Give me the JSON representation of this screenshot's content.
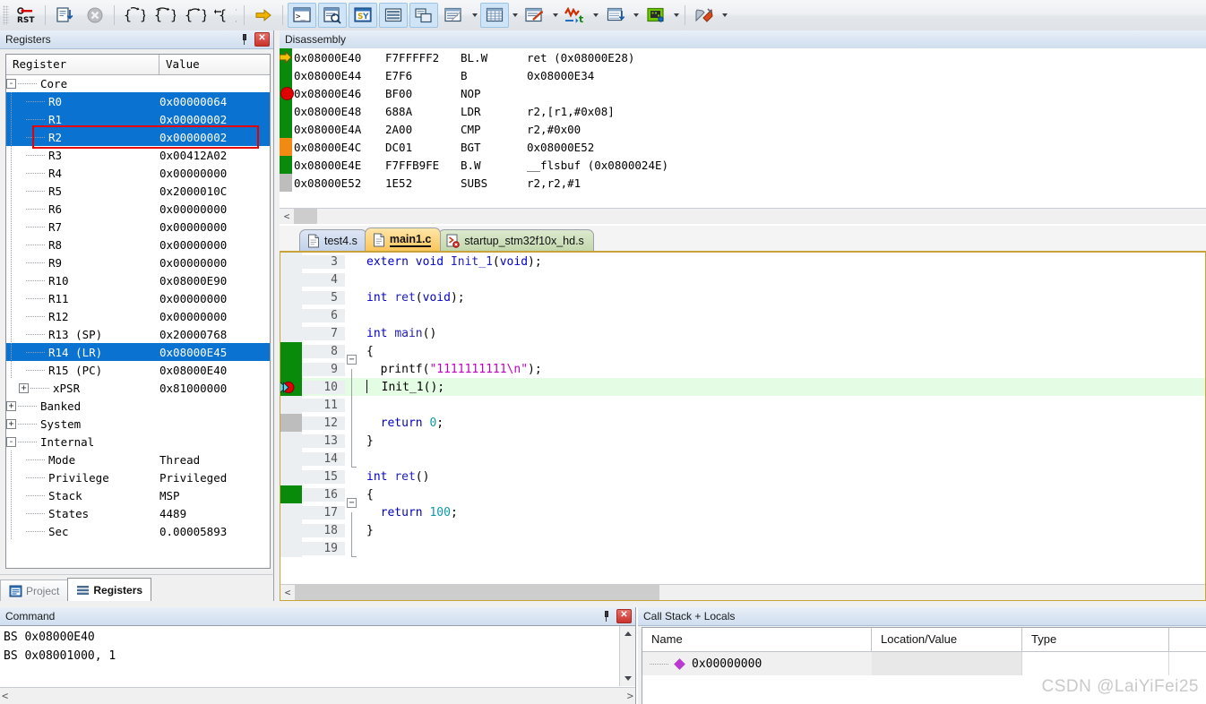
{
  "toolbar": {
    "buttons": [
      {
        "name": "reset-button",
        "icon": "reset-icon",
        "highlight": false
      },
      {
        "name": "step-into-file-button",
        "icon": "step-doc-icon",
        "highlight": false
      },
      {
        "name": "stop-button",
        "icon": "stop-disabled-icon",
        "highlight": false
      },
      {
        "name": "step-button",
        "icon": "step-brace-icon",
        "highlight": false
      },
      {
        "name": "step-over-button",
        "icon": "step-over-brace-icon",
        "highlight": false
      },
      {
        "name": "step-out-button",
        "icon": "step-out-brace-icon",
        "highlight": false
      },
      {
        "name": "run-to-cursor-button",
        "icon": "run-to-cursor-brace-icon",
        "highlight": false
      },
      {
        "name": "show-next-statement-button",
        "icon": "yellow-arrow-icon",
        "highlight": false
      },
      {
        "name": "command-window-button",
        "icon": "command-window-icon",
        "highlight": true
      },
      {
        "name": "disassembly-window-button",
        "icon": "disassembly-window-icon",
        "highlight": true
      },
      {
        "name": "symbols-window-button",
        "icon": "symbols-window-icon",
        "highlight": true
      },
      {
        "name": "registers-window-button",
        "icon": "registers-window-icon",
        "highlight": true
      },
      {
        "name": "call-stack-window-button",
        "icon": "call-stack-icon",
        "highlight": true
      },
      {
        "name": "watch-windows-button",
        "icon": "watch-window-icon",
        "highlight": false
      },
      {
        "name": "memory-windows-button",
        "icon": "memory-window-icon",
        "highlight": true
      },
      {
        "name": "serial-windows-button",
        "icon": "serial-window-icon",
        "highlight": false
      },
      {
        "name": "analysis-windows-button",
        "icon": "logic-analyzer-icon",
        "highlight": false
      },
      {
        "name": "trace-windows-button",
        "icon": "trace-window-icon",
        "highlight": false
      },
      {
        "name": "system-viewer-button",
        "icon": "peripherals-icon",
        "highlight": false
      },
      {
        "name": "tools-button",
        "icon": "tools-icon",
        "highlight": false
      }
    ]
  },
  "registers_panel": {
    "title": "Registers",
    "columns": [
      "Register",
      "Value"
    ],
    "rows": [
      {
        "label": "Core",
        "value": "",
        "depth": 0,
        "expander": "-",
        "selected": false
      },
      {
        "label": "R0",
        "value": "0x00000064",
        "depth": 1,
        "expander": "",
        "selected": true
      },
      {
        "label": "R1",
        "value": "0x00000002",
        "depth": 1,
        "expander": "",
        "selected": true
      },
      {
        "label": "R2",
        "value": "0x00000002",
        "depth": 1,
        "expander": "",
        "selected": true
      },
      {
        "label": "R3",
        "value": "0x00412A02",
        "depth": 1,
        "expander": "",
        "selected": false
      },
      {
        "label": "R4",
        "value": "0x00000000",
        "depth": 1,
        "expander": "",
        "selected": false
      },
      {
        "label": "R5",
        "value": "0x2000010C",
        "depth": 1,
        "expander": "",
        "selected": false
      },
      {
        "label": "R6",
        "value": "0x00000000",
        "depth": 1,
        "expander": "",
        "selected": false
      },
      {
        "label": "R7",
        "value": "0x00000000",
        "depth": 1,
        "expander": "",
        "selected": false
      },
      {
        "label": "R8",
        "value": "0x00000000",
        "depth": 1,
        "expander": "",
        "selected": false
      },
      {
        "label": "R9",
        "value": "0x00000000",
        "depth": 1,
        "expander": "",
        "selected": false
      },
      {
        "label": "R10",
        "value": "0x08000E90",
        "depth": 1,
        "expander": "",
        "selected": false
      },
      {
        "label": "R11",
        "value": "0x00000000",
        "depth": 1,
        "expander": "",
        "selected": false
      },
      {
        "label": "R12",
        "value": "0x00000000",
        "depth": 1,
        "expander": "",
        "selected": false
      },
      {
        "label": "R13 (SP)",
        "value": "0x20000768",
        "depth": 1,
        "expander": "",
        "selected": false
      },
      {
        "label": "R14 (LR)",
        "value": "0x08000E45",
        "depth": 1,
        "expander": "",
        "selected": true
      },
      {
        "label": "R15 (PC)",
        "value": "0x08000E40",
        "depth": 1,
        "expander": "",
        "selected": false
      },
      {
        "label": "xPSR",
        "value": "0x81000000",
        "depth": 1,
        "expander": "+",
        "selected": false
      },
      {
        "label": "Banked",
        "value": "",
        "depth": 0,
        "expander": "+",
        "selected": false
      },
      {
        "label": "System",
        "value": "",
        "depth": 0,
        "expander": "+",
        "selected": false
      },
      {
        "label": "Internal",
        "value": "",
        "depth": 0,
        "expander": "-",
        "selected": false
      },
      {
        "label": "Mode",
        "value": "Thread",
        "depth": 1,
        "expander": "",
        "selected": false
      },
      {
        "label": "Privilege",
        "value": "Privileged",
        "depth": 1,
        "expander": "",
        "selected": false
      },
      {
        "label": "Stack",
        "value": "MSP",
        "depth": 1,
        "expander": "",
        "selected": false
      },
      {
        "label": "States",
        "value": "4489",
        "depth": 1,
        "expander": "",
        "selected": false
      },
      {
        "label": "Sec",
        "value": "0.00005893",
        "depth": 1,
        "expander": "",
        "selected": false
      }
    ]
  },
  "left_dock_tabs": [
    {
      "label": "Project",
      "icon": "project-icon",
      "active": false
    },
    {
      "label": "Registers",
      "icon": "registers-icon",
      "active": true
    }
  ],
  "disassembly_panel": {
    "title": "Disassembly",
    "lines": [
      {
        "marker": "green",
        "pc": true,
        "breakpoint": false,
        "address": "0x08000E40",
        "hex": "F7FFFFF2",
        "mnemonic": "BL.W",
        "operands": "ret (0x08000E28)"
      },
      {
        "marker": "green",
        "pc": false,
        "breakpoint": false,
        "address": "0x08000E44",
        "hex": "E7F6",
        "mnemonic": "B",
        "operands": "0x08000E34"
      },
      {
        "marker": "green",
        "pc": false,
        "breakpoint": true,
        "address": "0x08000E46",
        "hex": "BF00",
        "mnemonic": "NOP",
        "operands": ""
      },
      {
        "marker": "green",
        "pc": false,
        "breakpoint": false,
        "address": "0x08000E48",
        "hex": "688A",
        "mnemonic": "LDR",
        "operands": "r2,[r1,#0x08]"
      },
      {
        "marker": "green",
        "pc": false,
        "breakpoint": false,
        "address": "0x08000E4A",
        "hex": "2A00",
        "mnemonic": "CMP",
        "operands": "r2,#0x00"
      },
      {
        "marker": "orange",
        "pc": false,
        "breakpoint": false,
        "address": "0x08000E4C",
        "hex": "DC01",
        "mnemonic": "BGT",
        "operands": "0x08000E52"
      },
      {
        "marker": "green",
        "pc": false,
        "breakpoint": false,
        "address": "0x08000E4E",
        "hex": "F7FFB9FE",
        "mnemonic": "B.W",
        "operands": "__flsbuf (0x0800024E)"
      },
      {
        "marker": "grey",
        "pc": false,
        "breakpoint": false,
        "address": "0x08000E52",
        "hex": "1E52",
        "mnemonic": "SUBS",
        "operands": "r2,r2,#1"
      }
    ]
  },
  "editor": {
    "tabs": [
      {
        "label": "test4.s",
        "style": "t-blue",
        "icon": "file-icon",
        "active": false
      },
      {
        "label": "main1.c",
        "style": "t-active",
        "icon": "file-icon",
        "active": true
      },
      {
        "label": "startup_stm32f10x_hd.s",
        "style": "t-green",
        "icon": "asm-file-error-icon",
        "active": false
      }
    ],
    "lines": [
      {
        "num": "3",
        "gutter": "none",
        "fold": "none",
        "current": false,
        "html": "<span class=\"k\">extern</span> <span class=\"k\">void</span> <span class=\"kb\">Init_1</span>(<span class=\"k\">void</span>);"
      },
      {
        "num": "4",
        "gutter": "none",
        "fold": "none",
        "current": false,
        "html": ""
      },
      {
        "num": "5",
        "gutter": "none",
        "fold": "none",
        "current": false,
        "html": "<span class=\"k\">int</span> <span class=\"kb\">ret</span>(<span class=\"k\">void</span>);"
      },
      {
        "num": "6",
        "gutter": "none",
        "fold": "none",
        "current": false,
        "html": ""
      },
      {
        "num": "7",
        "gutter": "none",
        "fold": "none",
        "current": false,
        "html": "<span class=\"k\">int</span> <span class=\"kb\">main</span>()"
      },
      {
        "num": "8",
        "gutter": "green",
        "fold": "box-minus",
        "current": false,
        "html": "{"
      },
      {
        "num": "9",
        "gutter": "green",
        "fold": "line",
        "current": false,
        "html": "  <span class=\"fn\">printf</span>(<span class=\"str\">\"1111111111\\n\"</span>);"
      },
      {
        "num": "10",
        "gutter": "green-bp",
        "fold": "line",
        "current": true,
        "html": "  <span class=\"fn\">Init_1</span>();"
      },
      {
        "num": "11",
        "gutter": "none",
        "fold": "line",
        "current": false,
        "html": ""
      },
      {
        "num": "12",
        "gutter": "grey",
        "fold": "line",
        "current": false,
        "html": "  <span class=\"k\">return</span> <span class=\"num\">0</span>;"
      },
      {
        "num": "13",
        "gutter": "none",
        "fold": "line",
        "current": false,
        "html": "}"
      },
      {
        "num": "14",
        "gutter": "none",
        "fold": "end",
        "current": false,
        "html": ""
      },
      {
        "num": "15",
        "gutter": "none",
        "fold": "none",
        "current": false,
        "html": "<span class=\"k\">int</span> <span class=\"kb\">ret</span>()"
      },
      {
        "num": "16",
        "gutter": "green",
        "fold": "box-minus",
        "current": false,
        "html": "{"
      },
      {
        "num": "17",
        "gutter": "none",
        "fold": "line",
        "current": false,
        "html": "  <span class=\"k\">return</span> <span class=\"num\">100</span>;"
      },
      {
        "num": "18",
        "gutter": "none",
        "fold": "line",
        "current": false,
        "html": "}"
      },
      {
        "num": "19",
        "gutter": "none",
        "fold": "end",
        "current": false,
        "html": ""
      }
    ]
  },
  "command_panel": {
    "title": "Command",
    "lines": [
      "BS 0x08000E40",
      "BS 0x08001000, 1"
    ]
  },
  "call_stack_panel": {
    "title": "Call Stack + Locals",
    "columns": [
      "Name",
      "Location/Value",
      "Type",
      ""
    ],
    "rows": [
      {
        "name": "0x00000000",
        "location": "",
        "type": ""
      }
    ]
  },
  "watermark": "CSDN @LaiYiFei25",
  "colors": {
    "selection": "#0a72d0",
    "annotation": "#e60000",
    "breakpoint": "#e00000",
    "pc_arrow": "#f2c200",
    "gutter_green": "#0a8a0a",
    "gutter_orange": "#f08a12",
    "current_line": "#e4fbe4"
  }
}
